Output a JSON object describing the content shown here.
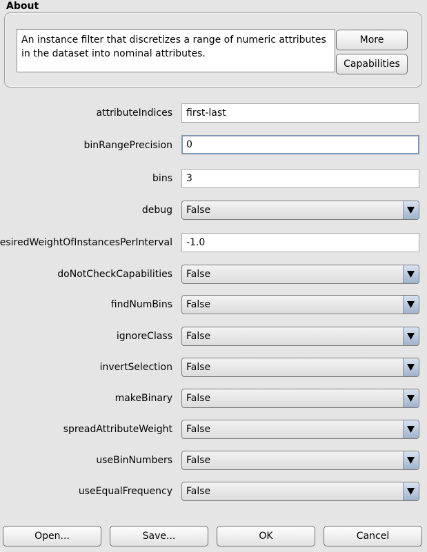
{
  "about": {
    "title": "About",
    "description": "An instance filter that discretizes a range of numeric attributes in the dataset into nominal attributes.",
    "more_label": "More",
    "capabilities_label": "Capabilities"
  },
  "properties": {
    "attributeIndices": {
      "label": "attributeIndices",
      "value": "first-last"
    },
    "binRangePrecision": {
      "label": "binRangePrecision",
      "value": "0"
    },
    "bins": {
      "label": "bins",
      "value": "3"
    },
    "debug": {
      "label": "debug",
      "value": "False"
    },
    "desiredWeight": {
      "label": "desiredWeightOfInstancesPerInterval",
      "value": "-1.0"
    },
    "doNotCheckCapabilities": {
      "label": "doNotCheckCapabilities",
      "value": "False"
    },
    "findNumBins": {
      "label": "findNumBins",
      "value": "False"
    },
    "ignoreClass": {
      "label": "ignoreClass",
      "value": "False"
    },
    "invertSelection": {
      "label": "invertSelection",
      "value": "False"
    },
    "makeBinary": {
      "label": "makeBinary",
      "value": "False"
    },
    "spreadAttributeWeight": {
      "label": "spreadAttributeWeight",
      "value": "False"
    },
    "useBinNumbers": {
      "label": "useBinNumbers",
      "value": "False"
    },
    "useEqualFrequency": {
      "label": "useEqualFrequency",
      "value": "False"
    }
  },
  "footer": {
    "open_label": "Open...",
    "save_label": "Save...",
    "ok_label": "OK",
    "cancel_label": "Cancel"
  },
  "icons": {
    "dropdown": "chevron-down-icon"
  },
  "colors": {
    "background": "#e5e5e5",
    "dropdown_arrow": "#9fb3cb",
    "focus_border": "#7f97b3"
  }
}
